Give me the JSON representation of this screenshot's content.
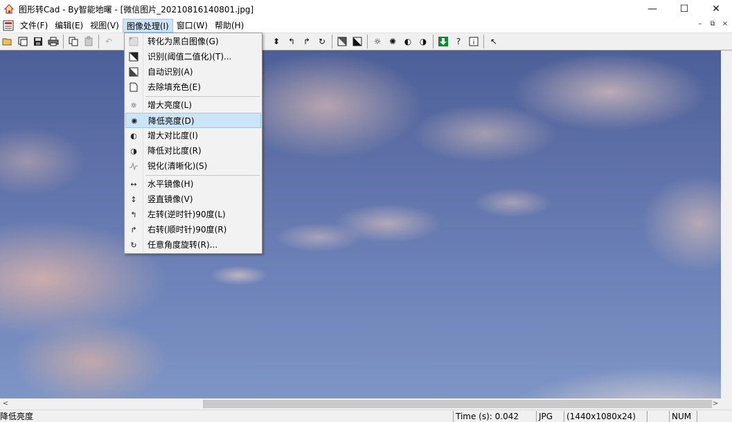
{
  "window": {
    "title": "图形转Cad - By智能地曙 - [微信图片_20210816140801.jpg]",
    "minimize_glyph": "—",
    "maximize_glyph": "☐",
    "close_glyph": "✕"
  },
  "menubar": {
    "items": [
      {
        "label": "文件(F)"
      },
      {
        "label": "编辑(E)"
      },
      {
        "label": "视图(V)"
      },
      {
        "label": "图像处理(I)"
      },
      {
        "label": "窗口(W)"
      },
      {
        "label": "帮助(H)"
      }
    ],
    "mdi_minimize": "–",
    "mdi_restore": "⧉",
    "mdi_close": "×"
  },
  "toolbar": {
    "icons": [
      "open-folder-icon",
      "new-window-icon",
      "save-icon",
      "print-icon",
      "copy-icon",
      "paste-icon",
      "undo-icon",
      "convert-icon",
      "brightness-icon",
      "rotate-left-icon",
      "rotate-right-icon",
      "rotate-any-icon",
      "binarize-icon",
      "auto-recognize-icon",
      "increase-brightness-icon",
      "decrease-brightness-icon",
      "increase-contrast-icon",
      "decrease-contrast-icon",
      "download-icon",
      "help-icon",
      "info-icon",
      "pointer-icon"
    ]
  },
  "dropdown": {
    "items": [
      {
        "icon": "grayscale-icon",
        "label": "转化为黑白图像(G)"
      },
      {
        "icon": "threshold-icon",
        "label": "识别(阈值二值化)(T)..."
      },
      {
        "icon": "auto-recognize-icon",
        "label": "自动识别(A)"
      },
      {
        "icon": "remove-fill-icon",
        "label": "去除填充色(E)"
      },
      {
        "icon": "increase-brightness-icon",
        "label": "增大亮度(L)"
      },
      {
        "icon": "decrease-brightness-icon",
        "label": "降低亮度(D)"
      },
      {
        "icon": "increase-contrast-icon",
        "label": "增大对比度(I)"
      },
      {
        "icon": "decrease-contrast-icon",
        "label": "降低对比度(R)"
      },
      {
        "icon": "sharpen-icon",
        "label": "锐化(清晰化)(S)"
      },
      {
        "icon": "mirror-horizontal-icon",
        "label": "水平镜像(H)"
      },
      {
        "icon": "mirror-vertical-icon",
        "label": "竖直镜像(V)"
      },
      {
        "icon": "rotate-left-icon",
        "label": "左转(逆时针)90度(L)"
      },
      {
        "icon": "rotate-right-icon",
        "label": "右转(顺时针)90度(R)"
      },
      {
        "icon": "rotate-any-icon",
        "label": "任意角度旋转(R)..."
      }
    ],
    "highlighted": "降低亮度(D)"
  },
  "statusbar": {
    "message": "降低亮度",
    "time": "Time (s): 0.042",
    "format": "JPG",
    "dimensions": "(1440x1080x24)",
    "num": "NUM"
  }
}
